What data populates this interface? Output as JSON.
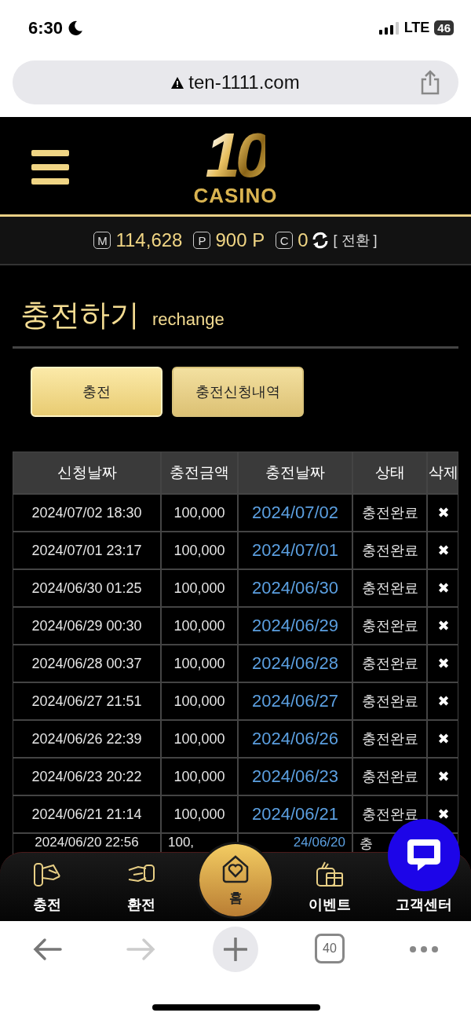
{
  "status_bar": {
    "time": "6:30",
    "network": "LTE",
    "battery": "46"
  },
  "browser": {
    "url": "ten-1111.com",
    "tab_count": "40"
  },
  "header": {
    "logo_number": "10",
    "logo_text": "CASINO"
  },
  "balance": [
    {
      "badge": "M",
      "value": "114,628"
    },
    {
      "badge": "P",
      "value": "900 P"
    },
    {
      "badge": "C",
      "value": "0"
    }
  ],
  "balance_switch": "[ 전환 ]",
  "page_title": {
    "title": "충전하기",
    "subtitle": "rechange"
  },
  "tabs": [
    {
      "label": "충전",
      "selected": true
    },
    {
      "label": "충전신청내역",
      "selected": false
    }
  ],
  "table": {
    "columns": [
      "신청날짜",
      "충전금액",
      "충전날짜",
      "상태",
      "삭제"
    ],
    "rows": [
      {
        "requested": "2024/07/02 18:30",
        "amount": "100,000",
        "charged": "2024/07/02",
        "status": "충전완료",
        "delete": "✖"
      },
      {
        "requested": "2024/07/01 23:17",
        "amount": "100,000",
        "charged": "2024/07/01",
        "status": "충전완료",
        "delete": "✖"
      },
      {
        "requested": "2024/06/30 01:25",
        "amount": "100,000",
        "charged": "2024/06/30",
        "status": "충전완료",
        "delete": "✖"
      },
      {
        "requested": "2024/06/29 00:30",
        "amount": "100,000",
        "charged": "2024/06/29",
        "status": "충전완료",
        "delete": "✖"
      },
      {
        "requested": "2024/06/28 00:37",
        "amount": "100,000",
        "charged": "2024/06/28",
        "status": "충전완료",
        "delete": "✖"
      },
      {
        "requested": "2024/06/27 21:51",
        "amount": "100,000",
        "charged": "2024/06/27",
        "status": "충전완료",
        "delete": "✖"
      },
      {
        "requested": "2024/06/26 22:39",
        "amount": "100,000",
        "charged": "2024/06/26",
        "status": "충전완료",
        "delete": "✖"
      },
      {
        "requested": "2024/06/23 20:22",
        "amount": "100,000",
        "charged": "2024/06/23",
        "status": "충전완료",
        "delete": "✖"
      },
      {
        "requested": "2024/06/21 21:14",
        "amount": "100,000",
        "charged": "2024/06/21",
        "status": "충전완료",
        "delete": "✖"
      },
      {
        "requested": "2024/06/20 22:56",
        "amount": "100,",
        "charged": "24/06/20",
        "status": "충"
      }
    ]
  },
  "bottom_nav": [
    {
      "label": "충전",
      "selected": false
    },
    {
      "label": "환전",
      "selected": false
    },
    {
      "label": "홈",
      "selected": true
    },
    {
      "label": "이벤트",
      "selected": false
    },
    {
      "label": "고객센터",
      "selected": false
    }
  ]
}
